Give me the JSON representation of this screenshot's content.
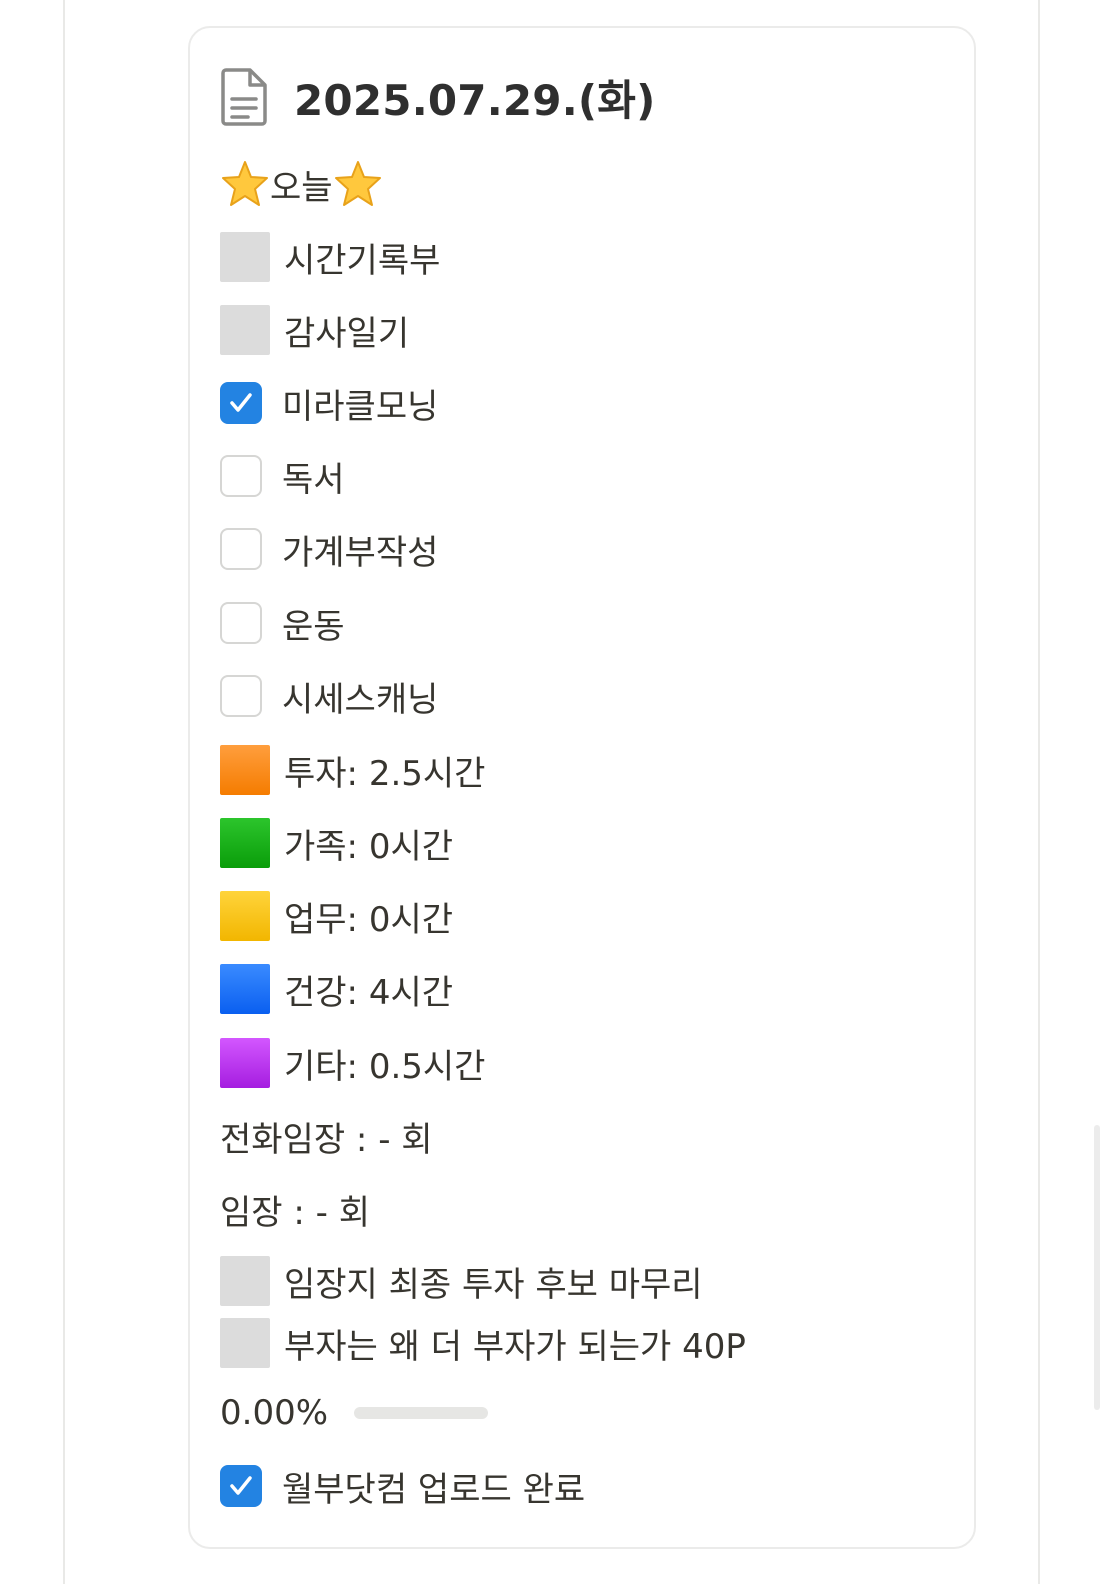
{
  "page": {
    "title": "2025.07.29.(화)",
    "title_icon": "document-icon"
  },
  "today_header": {
    "label": "오늘",
    "icon": "star-emoji"
  },
  "routines": [
    {
      "label": "시간기록부",
      "state": "gray-square"
    },
    {
      "label": "감사일기",
      "state": "gray-square"
    },
    {
      "label": "미라클모닝",
      "state": "checked"
    },
    {
      "label": "독서",
      "state": "unchecked"
    },
    {
      "label": "가계부작성",
      "state": "unchecked"
    },
    {
      "label": "운동",
      "state": "unchecked"
    },
    {
      "label": "시세스캐닝",
      "state": "unchecked"
    }
  ],
  "time_log": [
    {
      "label": "투자: 2.5시간",
      "color": "#f57c00"
    },
    {
      "label": "가족: 0시간",
      "color": "#0a9d0a"
    },
    {
      "label": "업무: 0시간",
      "color": "#f2b600"
    },
    {
      "label": "건강: 4시간",
      "color": "#0a5ff0"
    },
    {
      "label": "기타: 0.5시간",
      "color": "#a51de0"
    }
  ],
  "counts": {
    "phone_visit": "전화임장 : - 회",
    "site_visit": "임장 : - 회"
  },
  "tasks": [
    {
      "label": "임장지 최종 투자 후보 마무리",
      "state": "gray-square"
    },
    {
      "label": "부자는 왜 더 부자가 되는가 40P",
      "state": "gray-square"
    }
  ],
  "progress": {
    "label": "0.00%",
    "value": 0
  },
  "final_task": {
    "label": "월부닷컴 업로드 완료",
    "state": "checked"
  },
  "colors": {
    "accent": "#2383e2",
    "checkbox_border": "#d6d6d4",
    "gray_square": "#dcdcdc"
  }
}
